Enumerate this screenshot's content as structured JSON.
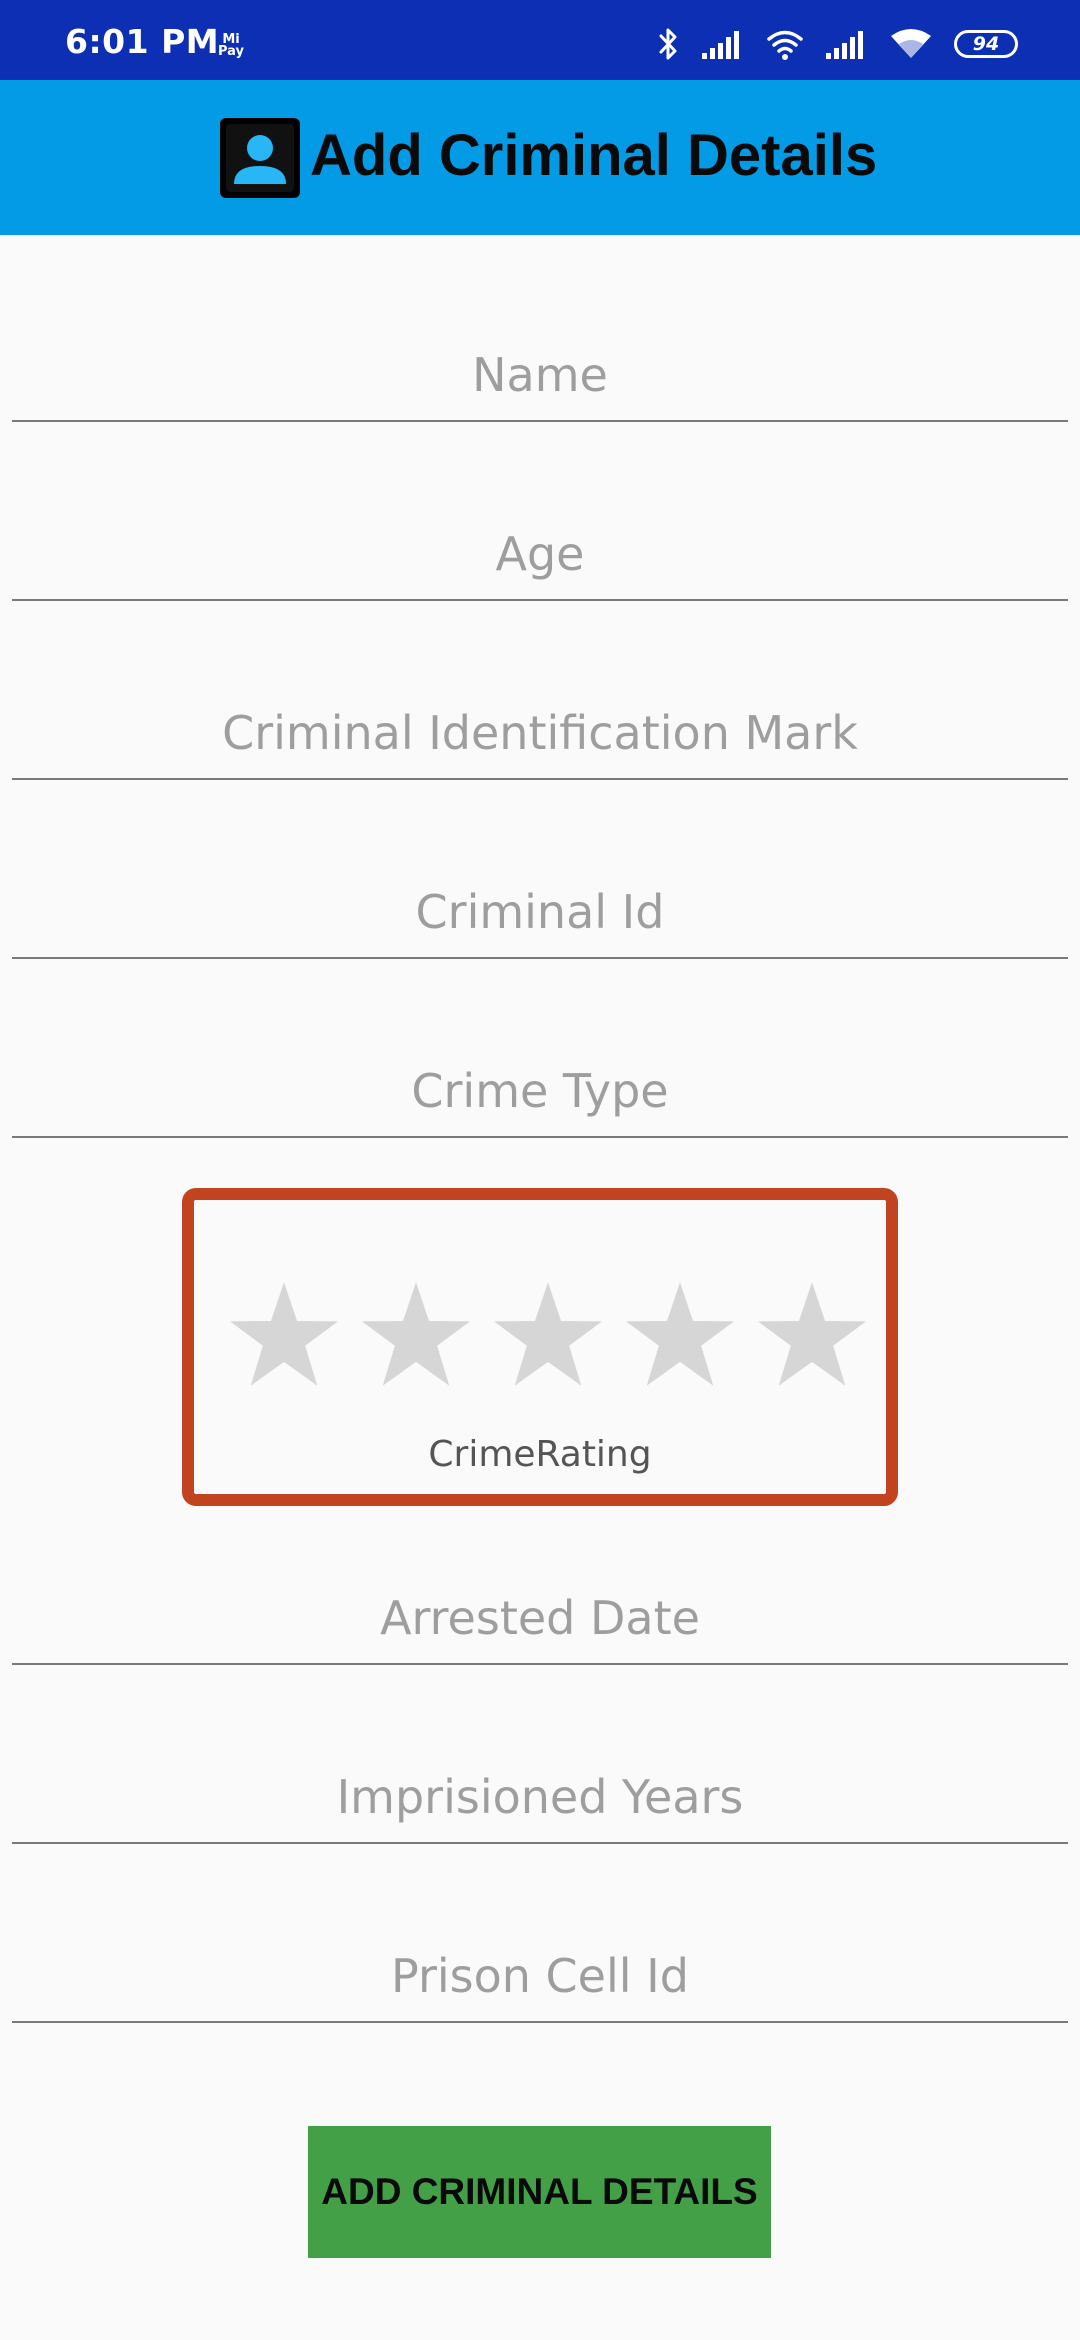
{
  "status_bar": {
    "time": "6:01 PM",
    "mipay": [
      "Mi",
      "Pay"
    ],
    "battery": "94"
  },
  "app_bar": {
    "title": "Add Criminal Details"
  },
  "form": {
    "name_placeholder": "Name",
    "age_placeholder": "Age",
    "mark_placeholder": "Criminal Identification Mark",
    "id_placeholder": "Criminal Id",
    "crime_type_placeholder": "Crime Type",
    "rating": {
      "label": "CrimeRating",
      "stars_total": 5,
      "stars_filled": 0,
      "star_color": "#d6d6d6",
      "border_color": "#c1431f"
    },
    "arrested_date_placeholder": "Arrested Date",
    "imprisoned_years_placeholder": "Imprisioned Years",
    "cell_id_placeholder": "Prison Cell Id",
    "submit_label": "ADD CRIMINAL DETAILS"
  },
  "colors": {
    "status_bar": "#0c2fb4",
    "app_bar": "#039be5",
    "button": "#43a047"
  }
}
